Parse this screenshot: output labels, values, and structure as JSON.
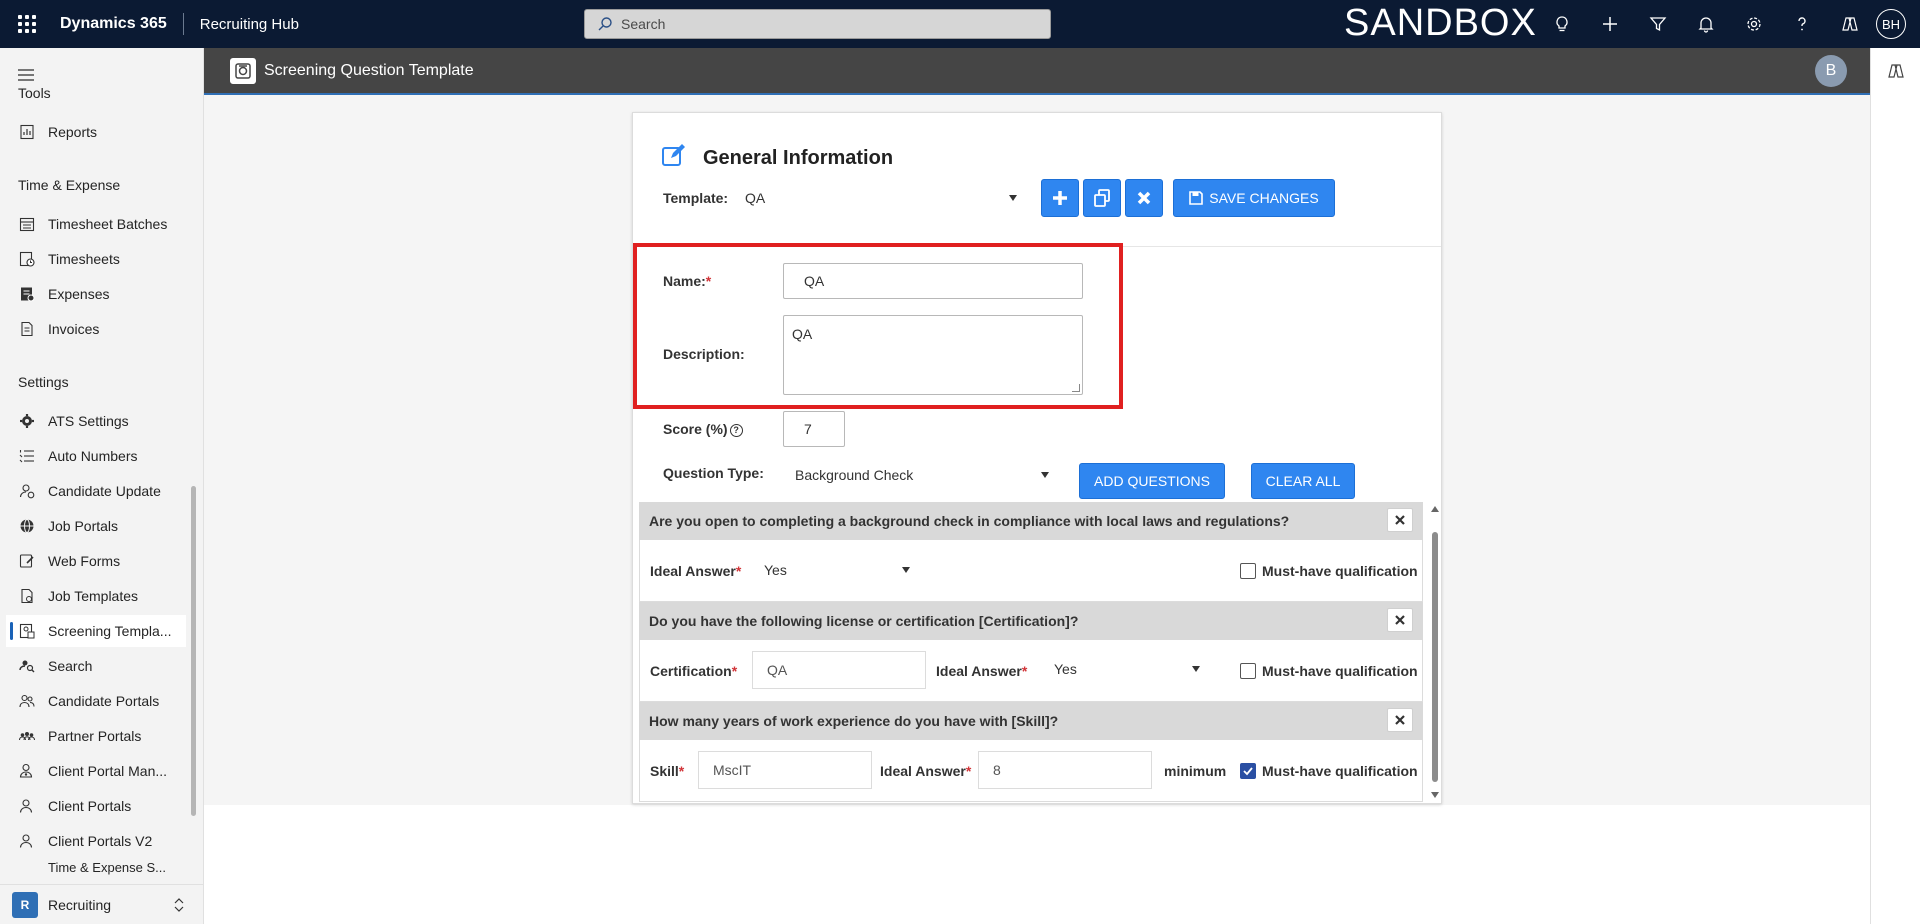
{
  "topbar": {
    "brand": "Dynamics 365",
    "app": "Recruiting Hub",
    "search_placeholder": "Search",
    "environment": "SANDBOX",
    "user_initials": "BH",
    "icons": [
      "lightbulb-icon",
      "plus-icon",
      "filter-icon",
      "bell-icon",
      "gear-icon",
      "help-icon",
      "copilot-icon"
    ]
  },
  "nav": {
    "sections": {
      "tools": "Tools",
      "time_expense": "Time & Expense",
      "settings": "Settings"
    },
    "items": [
      {
        "label": "Reports",
        "icon": "report-icon"
      },
      {
        "label": "Timesheet Batches",
        "icon": "calendar-icon"
      },
      {
        "label": "Timesheets",
        "icon": "timesheet-icon"
      },
      {
        "label": "Expenses",
        "icon": "expense-icon"
      },
      {
        "label": "Invoices",
        "icon": "invoice-icon"
      },
      {
        "label": "ATS Settings",
        "icon": "gear-icon"
      },
      {
        "label": "Auto Numbers",
        "icon": "list-numbered-icon"
      },
      {
        "label": "Candidate Update",
        "icon": "person-sync-icon"
      },
      {
        "label": "Job Portals",
        "icon": "globe-icon"
      },
      {
        "label": "Web Forms",
        "icon": "form-icon"
      },
      {
        "label": "Job Templates",
        "icon": "template-icon"
      },
      {
        "label": "Screening Templa...",
        "icon": "screening-icon"
      },
      {
        "label": "Search",
        "icon": "search-people-icon"
      },
      {
        "label": "Candidate Portals",
        "icon": "people-icon"
      },
      {
        "label": "Partner Portals",
        "icon": "group-icon"
      },
      {
        "label": "Client Portal Man...",
        "icon": "person-key-icon"
      },
      {
        "label": "Client Portals",
        "icon": "person-icon"
      },
      {
        "label": "Client Portals V2",
        "icon": "person-icon"
      },
      {
        "label": "Time & Expense S...",
        "icon": "settings-icon"
      }
    ],
    "area": {
      "badge": "R",
      "label": "Recruiting"
    }
  },
  "page": {
    "title": "Screening Question Template",
    "avatar": "B"
  },
  "general": {
    "title": "General Information",
    "template_label": "Template:",
    "template_value": "QA",
    "save_label": "SAVE CHANGES",
    "name_label": "Name:",
    "name_value": "QA",
    "description_label": "Description:",
    "description_value": "QA",
    "score_label": "Score (%)",
    "score_value": "7",
    "qtype_label": "Question Type:",
    "qtype_value": "Background Check",
    "add_questions": "ADD QUESTIONS",
    "clear_all": "CLEAR ALL",
    "required_mark": "*"
  },
  "questions": [
    {
      "text": "Are you open to completing a background check in compliance with local laws and regulations?",
      "ideal_label": "Ideal Answer",
      "ideal_value": "Yes",
      "must_have": false
    },
    {
      "text": "Do you have the following license or certification [Certification]?",
      "cert_label": "Certification",
      "cert_value": "QA",
      "ideal_label": "Ideal Answer",
      "ideal_value": "Yes",
      "must_have": false
    },
    {
      "text": "How many years of work experience do you have with [Skill]?",
      "skill_label": "Skill",
      "skill_value": "MscIT",
      "ideal_label": "Ideal Answer",
      "ideal_value": "8",
      "minimum_label": "minimum",
      "must_have": true
    }
  ],
  "must_have_label": "Must-have qualification",
  "colors": {
    "topbar": "#0b1a33",
    "pagebar": "#454545",
    "primary_button": "#2f86f0",
    "highlight": "#e02020",
    "required": "#d13438"
  }
}
